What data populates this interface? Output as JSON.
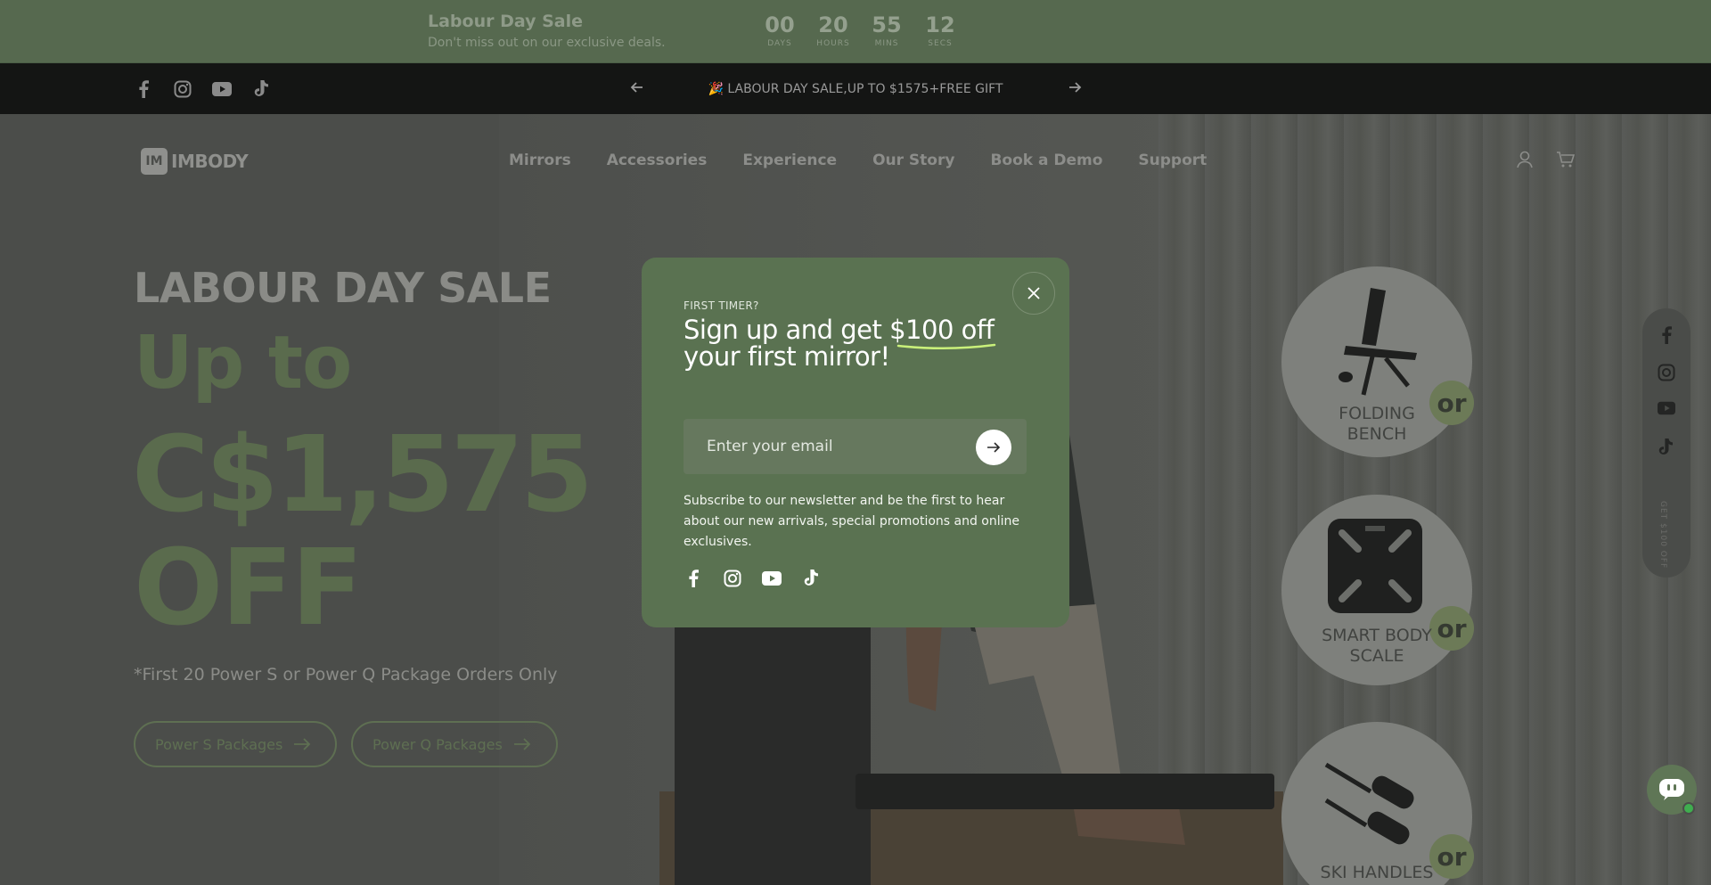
{
  "countdown": {
    "title": "Labour Day Sale",
    "subtitle": "Don't miss out on our exclusive deals.",
    "units": [
      {
        "value": "00",
        "label": "DAYS"
      },
      {
        "value": "20",
        "label": "HOURS"
      },
      {
        "value": "55",
        "label": "MINS"
      },
      {
        "value": "12",
        "label": "SECS"
      }
    ]
  },
  "announcement": {
    "social_icons": [
      "facebook-icon",
      "instagram-icon",
      "youtube-icon",
      "tiktok-icon"
    ],
    "text": "🎉 LABOUR DAY SALE,UP TO $1575+FREE GIFT",
    "prev_icon": "arrow-left-icon",
    "next_icon": "arrow-right-icon"
  },
  "header": {
    "logo_mark": "IM",
    "logo_text": "IMBODY",
    "nav": [
      "Mirrors",
      "Accessories",
      "Experience",
      "Our Story",
      "Book a Demo",
      "Support"
    ],
    "icons": [
      "account-icon",
      "cart-icon"
    ]
  },
  "hero": {
    "eyebrow": "LABOUR DAY SALE",
    "line1": "Up to",
    "line2": "C$1,575",
    "line3": "OFF",
    "note": "*First 20 Power S or Power Q Package Orders Only",
    "buttons": [
      {
        "label": "Power S Packages"
      },
      {
        "label": "Power Q Packages"
      }
    ],
    "gifts": [
      {
        "or": "or",
        "label_line1": "FOLDING",
        "label_line2": "BENCH"
      },
      {
        "or": "or",
        "label_line1": "SMART BODY",
        "label_line2": "SCALE"
      },
      {
        "or": "or",
        "label_line1": "SKI HANDLES",
        "label_line2": ""
      }
    ]
  },
  "side_rail": {
    "icons": [
      "facebook-icon",
      "instagram-icon",
      "youtube-icon",
      "tiktok-icon"
    ],
    "text": "GET $100 OFF"
  },
  "modal": {
    "eyebrow": "FIRST TIMER?",
    "title_part1": "Sign up and get ",
    "title_highlight": "$100 off",
    "title_part2": "your first mirror!",
    "email_placeholder": "Enter your email",
    "description": "Subscribe to our newsletter and be the first to hear about our new arrivals, special promotions and online exclusives.",
    "social_icons": [
      "facebook-icon",
      "instagram-icon",
      "youtube-icon",
      "tiktok-icon"
    ],
    "underline_color": "#c9f07a"
  },
  "colors": {
    "modal_bg": "#5a7251",
    "accent_green": "#5a6b4d",
    "chat_online": "#3fae4f"
  }
}
